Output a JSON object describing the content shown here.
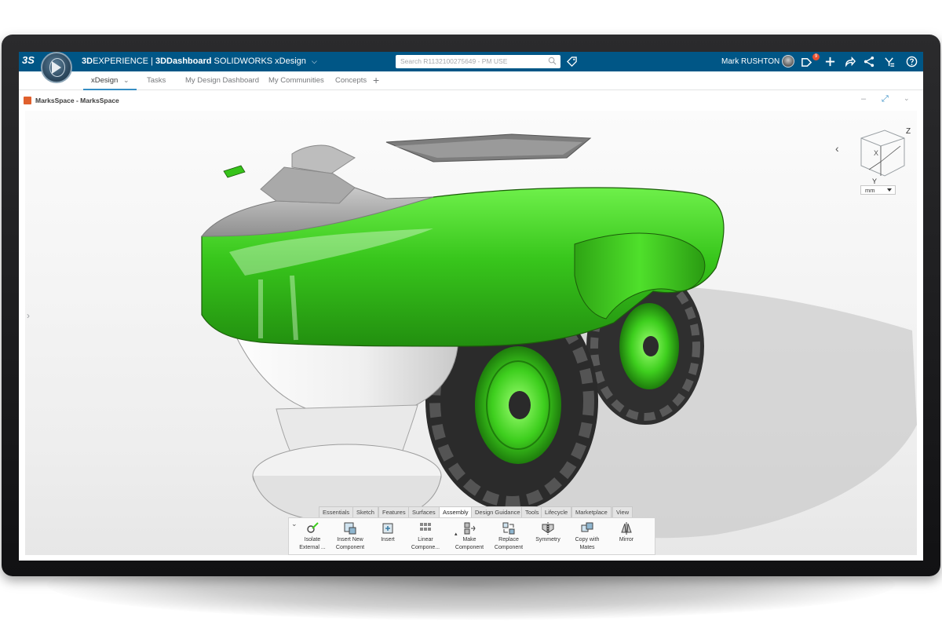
{
  "topbar": {
    "logo": "3S",
    "brand": "3D",
    "brand_rest": "EXPERIENCE | ",
    "dashboard": "3DDashboard",
    "app": "SOLIDWORKS xDesign",
    "search_placeholder": "Search R1132100275649 - PM USE",
    "user_name": "Mark RUSHTON",
    "notification_count": "9",
    "icons": [
      "search-icon",
      "tag-icon",
      "notifications-icon",
      "add-icon",
      "share-icon",
      "share-network-icon",
      "apps-icon",
      "help-icon"
    ]
  },
  "tabs": [
    {
      "label": "xDesign",
      "active": true
    },
    {
      "label": "Tasks"
    },
    {
      "label": "My Design Dashboard"
    },
    {
      "label": "My Communities"
    },
    {
      "label": "Concepts"
    }
  ],
  "widget": {
    "title": "MarksSpace - MarksSpace"
  },
  "view_cube": {
    "axis_x": "X",
    "axis_y": "Y",
    "axis_z": "Z"
  },
  "units": {
    "selected": "mm"
  },
  "action_tabs": [
    "Essentials",
    "Sketch",
    "Features",
    "Surfaces",
    "Assembly",
    "Design Guidance",
    "Tools",
    "Lifecycle",
    "Marketplace",
    "View"
  ],
  "active_action_tab": "Assembly",
  "commands": [
    {
      "label1": "Isolate",
      "label2": "External ..."
    },
    {
      "label1": "Insert New",
      "label2": "Component"
    },
    {
      "label1": "Insert",
      "label2": ""
    },
    {
      "label1": "Linear",
      "label2": "Compone..."
    },
    {
      "label1": "Make",
      "label2": "Component"
    },
    {
      "label1": "Replace",
      "label2": "Component"
    },
    {
      "label1": "Symmetry",
      "label2": ""
    },
    {
      "label1": "Copy with",
      "label2": "Mates"
    },
    {
      "label1": "Mirror",
      "label2": ""
    }
  ],
  "colors": {
    "header": "#005686",
    "accent": "#368ec4",
    "model_green": "#3ecf1e",
    "badge": "#ea4f2f"
  }
}
